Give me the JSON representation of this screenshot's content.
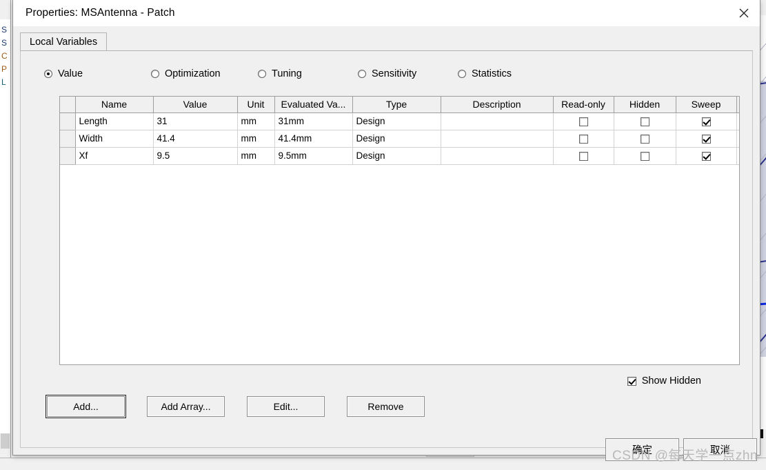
{
  "background": {
    "tree_items": [
      "S",
      "S",
      "C",
      "P",
      "L"
    ],
    "plot_label": ""
  },
  "dialog": {
    "title": "Properties: MSAntenna - Patch",
    "close_icon": "close-icon",
    "tab": {
      "label": "Local Variables"
    },
    "modes": [
      {
        "label": "Value",
        "checked": true
      },
      {
        "label": "Optimization",
        "checked": false
      },
      {
        "label": "Tuning",
        "checked": false
      },
      {
        "label": "Sensitivity",
        "checked": false
      },
      {
        "label": "Statistics",
        "checked": false
      }
    ],
    "grid": {
      "columns": [
        "Name",
        "Value",
        "Unit",
        "Evaluated Va...",
        "Type",
        "Description",
        "Read-only",
        "Hidden",
        "Sweep"
      ],
      "rows": [
        {
          "name": "Length",
          "value": "31",
          "unit": "mm",
          "evaluated": "31mm",
          "type": "Design",
          "description": "",
          "read_only": false,
          "hidden": false,
          "sweep": true
        },
        {
          "name": "Width",
          "value": "41.4",
          "unit": "mm",
          "evaluated": "41.4mm",
          "type": "Design",
          "description": "",
          "read_only": false,
          "hidden": false,
          "sweep": true
        },
        {
          "name": "Xf",
          "value": "9.5",
          "unit": "mm",
          "evaluated": "9.5mm",
          "type": "Design",
          "description": "",
          "read_only": false,
          "hidden": false,
          "sweep": true
        }
      ]
    },
    "show_hidden": {
      "label": "Show Hidden",
      "checked": true
    },
    "buttons": [
      {
        "label": "Add...",
        "focused": true
      },
      {
        "label": "Add Array...",
        "focused": false
      },
      {
        "label": "Edit...",
        "focused": false
      },
      {
        "label": "Remove",
        "focused": false
      }
    ],
    "confirm_buttons": [
      {
        "label": "确定"
      },
      {
        "label": "取消"
      }
    ]
  },
  "watermark": {
    "text": "CSDN @每天学一点zhn"
  }
}
